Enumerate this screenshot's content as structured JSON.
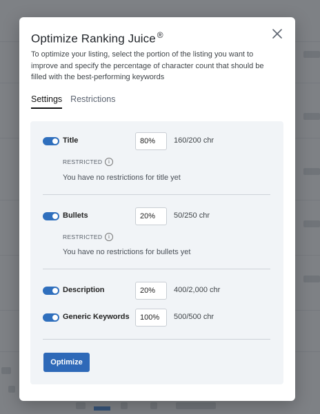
{
  "modal": {
    "title": "Optimize Ranking Juice",
    "title_mark": "®",
    "description": "To optimize your listing, select the portion of the listing you want to improve and specify the percentage of character count that should be filled with the best-performing keywords",
    "close_icon": "close-icon"
  },
  "tabs": [
    {
      "label": "Settings",
      "active": true
    },
    {
      "label": "Restrictions",
      "active": false
    }
  ],
  "fields": {
    "title": {
      "label": "Title",
      "enabled": true,
      "percent": "80%",
      "chars": "160/200 chr",
      "restricted_label": "RESTRICTED",
      "restriction_text": "You have no restrictions for title yet"
    },
    "bullets": {
      "label": "Bullets",
      "enabled": true,
      "percent": "20%",
      "chars": "50/250 chr",
      "restricted_label": "RESTRICTED",
      "restriction_text": "You have no restrictions for bullets yet"
    },
    "description": {
      "label": "Description",
      "enabled": true,
      "percent": "20%",
      "chars": "400/2,000 chr"
    },
    "generic_keywords": {
      "label": "Generic Keywords",
      "enabled": true,
      "percent": "100%",
      "chars": "500/500 chr"
    }
  },
  "actions": {
    "optimize_label": "Optimize"
  },
  "colors": {
    "accent": "#2e69b8",
    "panel_bg": "#f1f4f7",
    "overlay": "#6f7378"
  }
}
